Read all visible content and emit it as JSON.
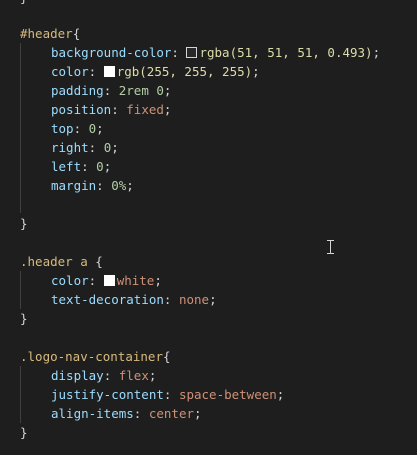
{
  "code": {
    "top_brace": "}",
    "blocks": [
      {
        "selector": "#header",
        "open": "{",
        "declarations": [
          {
            "prop": "background-color",
            "value": "rgba(51, 51, 51, 0.493)",
            "swatch": "rgba(51,51,51,0.493)"
          },
          {
            "prop": "color",
            "value": "rgb(255, 255, 255)",
            "swatch": "#ffffff"
          },
          {
            "prop": "padding",
            "value_num": "2rem",
            "value_rest": " 0"
          },
          {
            "prop": "position",
            "value": "fixed"
          },
          {
            "prop": "top",
            "value": "0"
          },
          {
            "prop": "right",
            "value": "0"
          },
          {
            "prop": "left",
            "value": "0"
          },
          {
            "prop": "margin",
            "value": "0%"
          }
        ],
        "close": "}"
      },
      {
        "selector": ".header a",
        "open": " {",
        "declarations": [
          {
            "prop": "color",
            "value": "white",
            "swatch": "#ffffff"
          },
          {
            "prop": "text-decoration",
            "value": "none"
          }
        ],
        "close": "}"
      },
      {
        "selector": ".logo-nav-container",
        "open": "{",
        "declarations": [
          {
            "prop": "display",
            "value": "flex"
          },
          {
            "prop": "justify-content",
            "value": "space-between"
          },
          {
            "prop": "align-items",
            "value": "center"
          }
        ],
        "close": "}"
      }
    ]
  },
  "theme": {
    "background": "#1e1e1e",
    "selector_color": "#d7ba7d",
    "property_color": "#9cdcfe",
    "number_color": "#b5cea8",
    "string_color": "#ce9178"
  },
  "cursor_icon": "text-cursor-icon"
}
